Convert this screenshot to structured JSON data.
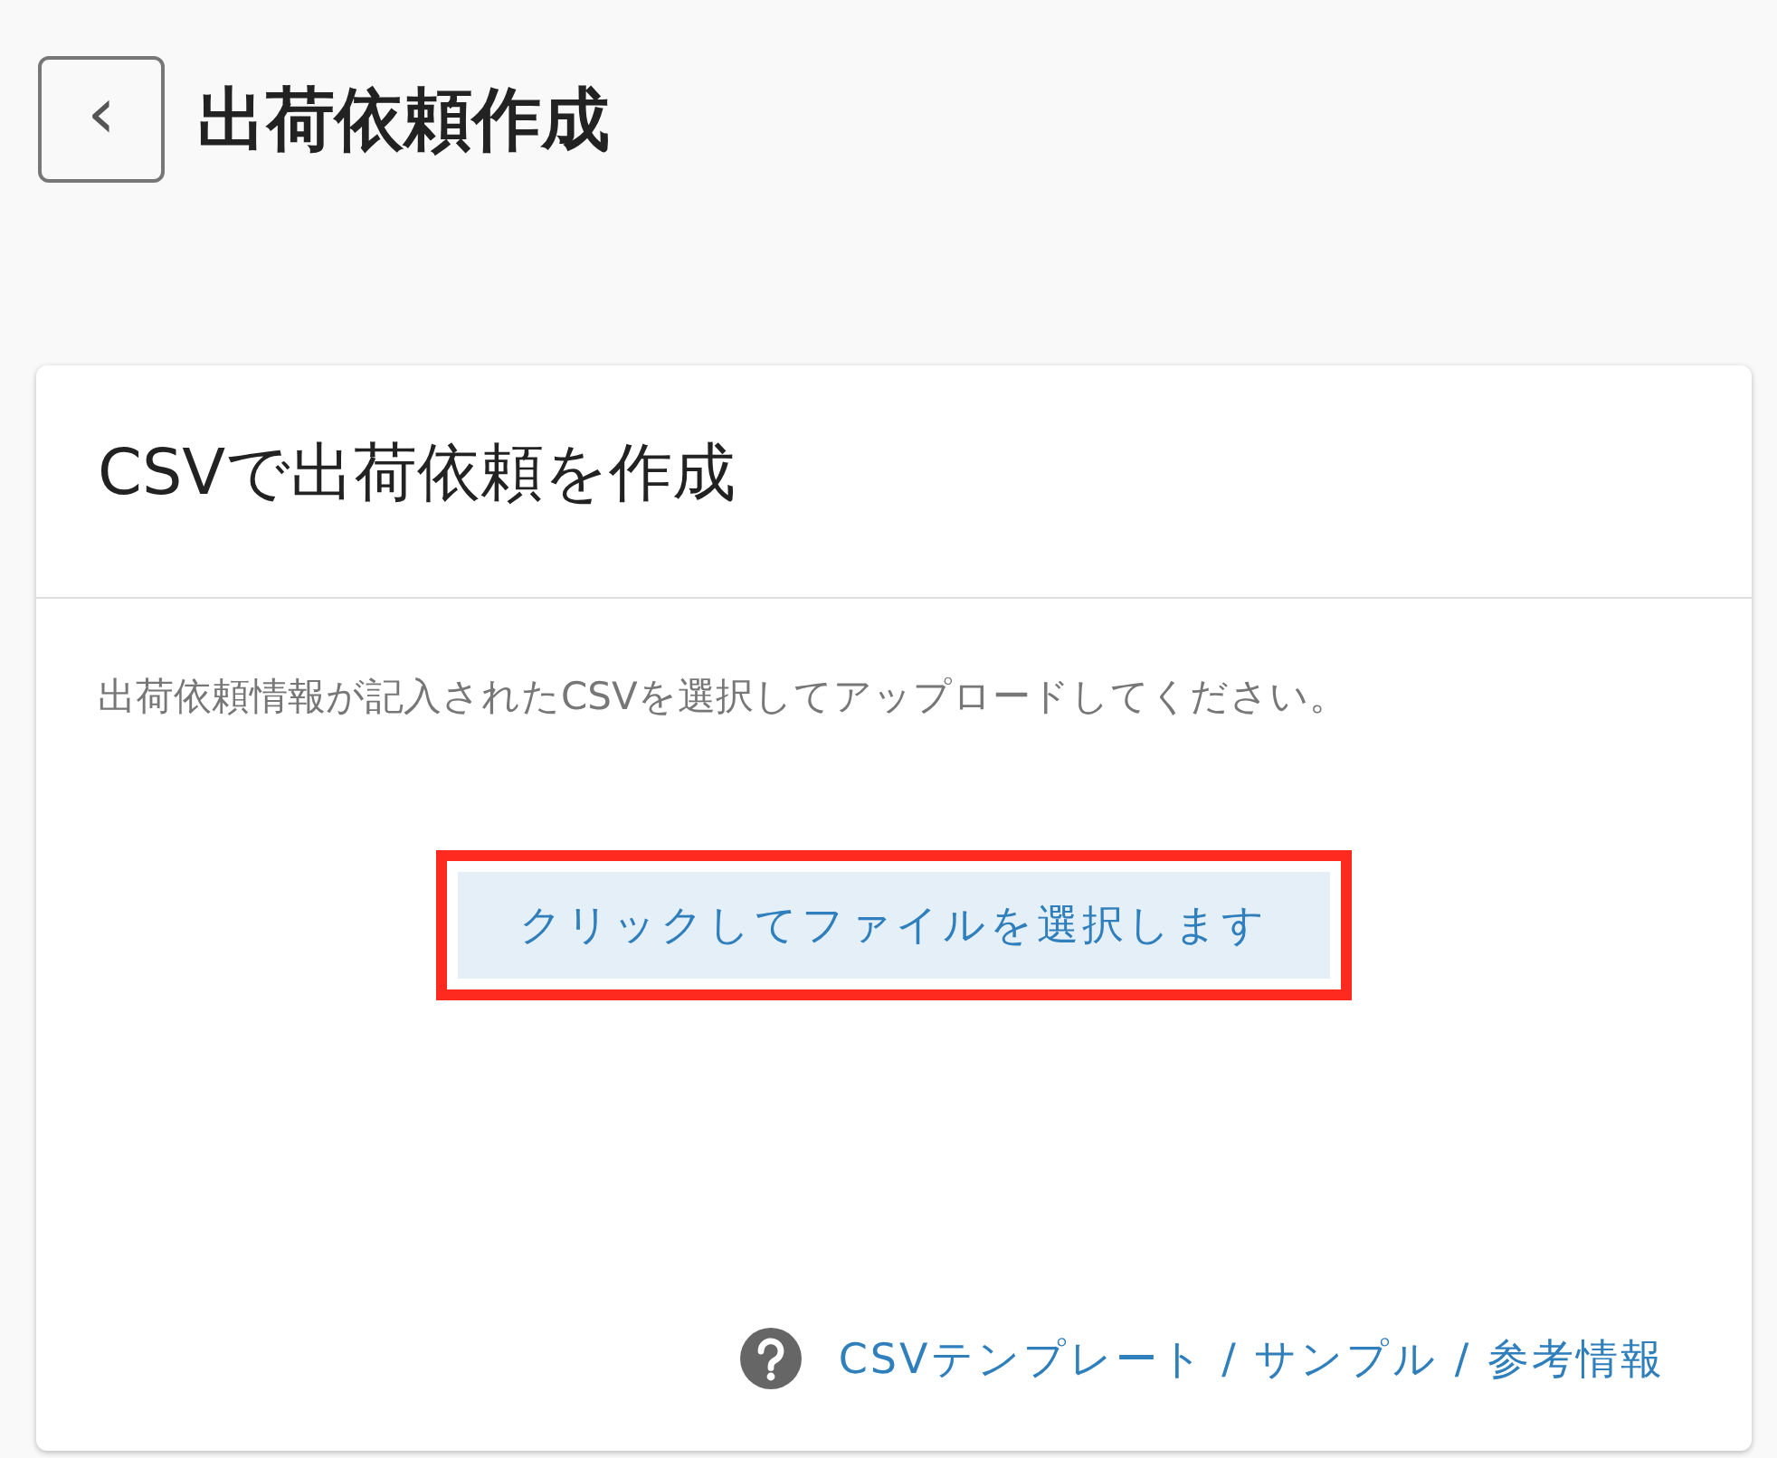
{
  "header": {
    "back_icon": "‹",
    "title": "出荷依頼作成"
  },
  "card": {
    "title": "CSVで出荷依頼を作成",
    "description": "出荷依頼情報が記入されたCSVを選択してアップロードしてください。",
    "upload_button": {
      "label": "クリックしてファイルを選択します",
      "highlighted": true
    },
    "help_link": "CSVテンプレート / サンプル / 参考情報"
  }
}
